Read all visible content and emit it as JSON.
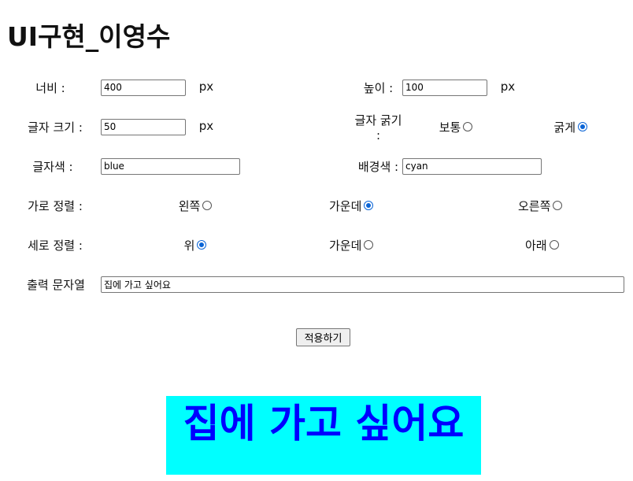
{
  "page": {
    "title": "UI구현_이영수"
  },
  "form": {
    "width": {
      "label": "너비 :",
      "value": "400",
      "unit": "px"
    },
    "height": {
      "label": "높이 :",
      "value": "100",
      "unit": "px"
    },
    "font_size": {
      "label": "글자 크기 :",
      "value": "50",
      "unit": "px"
    },
    "font_weight": {
      "label": "글자 굵기 :",
      "options": [
        {
          "label": "보통",
          "checked": false
        },
        {
          "label": "굵게",
          "checked": true
        }
      ]
    },
    "text_color": {
      "label": "글자색 :",
      "value": "blue"
    },
    "bg_color": {
      "label": "배경색 :",
      "value": "cyan"
    },
    "h_align": {
      "label": "가로 정렬 :",
      "options": [
        {
          "label": "왼쪽",
          "checked": false
        },
        {
          "label": "가운데",
          "checked": true
        },
        {
          "label": "오른쪽",
          "checked": false
        }
      ]
    },
    "v_align": {
      "label": "세로 정렬 :",
      "options": [
        {
          "label": "위",
          "checked": true
        },
        {
          "label": "가운데",
          "checked": false
        },
        {
          "label": "아래",
          "checked": false
        }
      ]
    },
    "output_text": {
      "label": "출력 문자열",
      "value": "집에 가고 싶어요"
    },
    "apply_button": "적용하기"
  },
  "output": {
    "text": "집에 가고 싶어요",
    "color": "#0000ff",
    "background": "#00ffff"
  }
}
